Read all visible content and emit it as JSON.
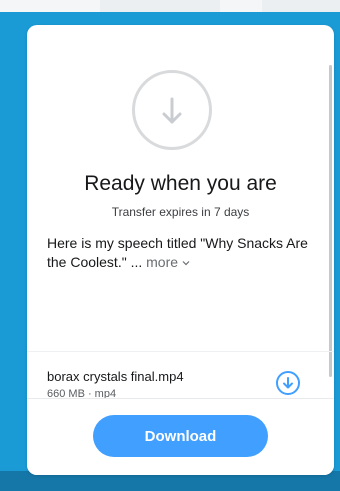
{
  "transfer": {
    "title": "Ready when you are",
    "expiry": "Transfer expires in 7 days",
    "message": "Here is my speech titled \"Why Snacks Are the Coolest.\" ...",
    "more_label": "more",
    "more_icon": "chevron-down-icon"
  },
  "file": {
    "name": "borax crystals final.mp4",
    "meta": "660 MB · mp4",
    "download_icon": "download-icon"
  },
  "footer": {
    "download_label": "Download"
  },
  "colors": {
    "background": "#1a9bd6",
    "accent": "#409fff"
  }
}
